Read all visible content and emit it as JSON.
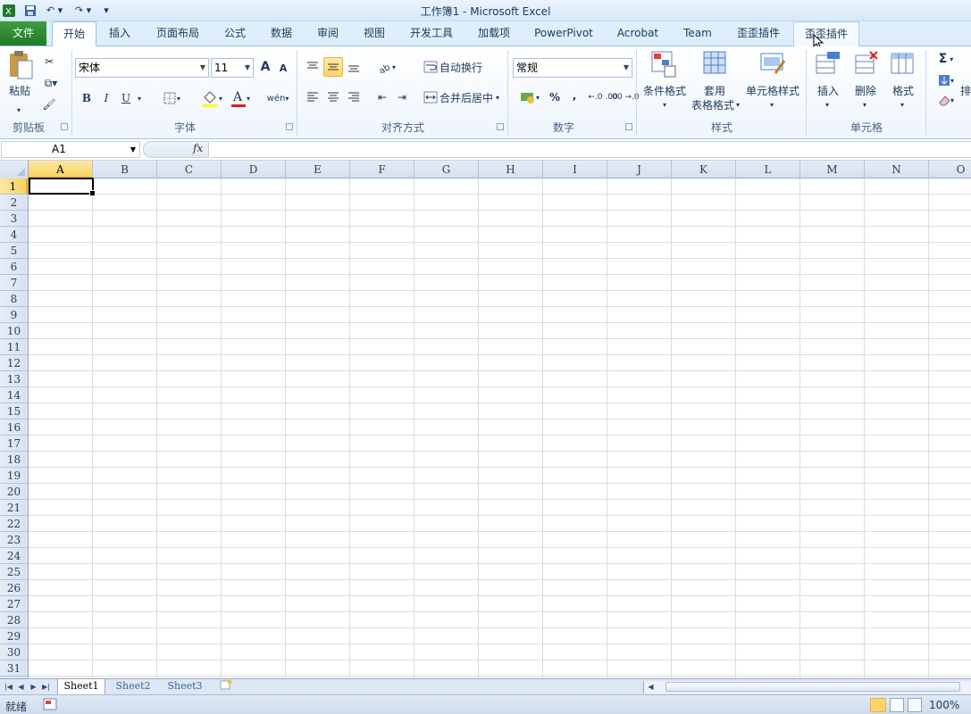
{
  "window": {
    "title": "工作簿1 - Microsoft Excel"
  },
  "quick_access": [
    "excel-logo-icon",
    "save-icon",
    "undo-icon",
    "redo-icon",
    "customize-icon"
  ],
  "tabs": [
    {
      "label": "文件",
      "kind": "file"
    },
    {
      "label": "开始",
      "kind": "active"
    },
    {
      "label": "插入",
      "kind": ""
    },
    {
      "label": "页面布局",
      "kind": ""
    },
    {
      "label": "公式",
      "kind": ""
    },
    {
      "label": "数据",
      "kind": ""
    },
    {
      "label": "审阅",
      "kind": ""
    },
    {
      "label": "视图",
      "kind": ""
    },
    {
      "label": "开发工具",
      "kind": ""
    },
    {
      "label": "加载项",
      "kind": ""
    },
    {
      "label": "PowerPivot",
      "kind": ""
    },
    {
      "label": "Acrobat",
      "kind": ""
    },
    {
      "label": "Team",
      "kind": ""
    },
    {
      "label": "歪歪插件",
      "kind": ""
    },
    {
      "label": "歪歪插件",
      "kind": "hover"
    }
  ],
  "ribbon": {
    "clipboard": {
      "label": "剪贴板",
      "paste": "粘贴"
    },
    "font": {
      "label": "字体",
      "name": "宋体",
      "size": "11",
      "bold": "B",
      "italic": "I",
      "underline": "U",
      "grow": "A",
      "shrink": "A",
      "wen": "wén"
    },
    "alignment": {
      "label": "对齐方式",
      "wrap": "自动换行",
      "merge": "合并后居中"
    },
    "number": {
      "label": "数字",
      "format": "常规",
      "percent": "%",
      "comma": ",",
      "inc": "←.0 .00",
      "dec": ".00 →.0"
    },
    "styles": {
      "label": "样式",
      "conditional": "条件格式",
      "table_line1": "套用",
      "table_line2": "表格格式",
      "cell_styles": "单元格样式"
    },
    "cells": {
      "label": "单元格",
      "insert": "插入",
      "delete": "删除",
      "format": "格式"
    },
    "editing": {
      "sum": "Σ",
      "sort_partial": "排"
    }
  },
  "formula_bar": {
    "name_box": "A1",
    "fx": "fx",
    "value": ""
  },
  "columns": [
    "A",
    "B",
    "C",
    "D",
    "E",
    "F",
    "G",
    "H",
    "I",
    "J",
    "K",
    "L",
    "M",
    "N",
    "O"
  ],
  "rows": [
    "1",
    "2",
    "3",
    "4",
    "5",
    "6",
    "7",
    "8",
    "9",
    "10",
    "11",
    "12",
    "13",
    "14",
    "15",
    "16",
    "17",
    "18",
    "19",
    "20",
    "21",
    "22",
    "23",
    "24",
    "25",
    "26",
    "27",
    "28",
    "29",
    "30",
    "31"
  ],
  "active_cell": {
    "col": "A",
    "row": "1"
  },
  "sheets": [
    {
      "label": "Sheet1",
      "active": true
    },
    {
      "label": "Sheet2",
      "active": false
    },
    {
      "label": "Sheet3",
      "active": false
    }
  ],
  "status": {
    "ready": "就绪",
    "zoom": "100%"
  },
  "colors": {
    "file_tab": "#2a8a31",
    "accent_selected": "#f9d262",
    "header_bg": "#dfe8f4"
  }
}
